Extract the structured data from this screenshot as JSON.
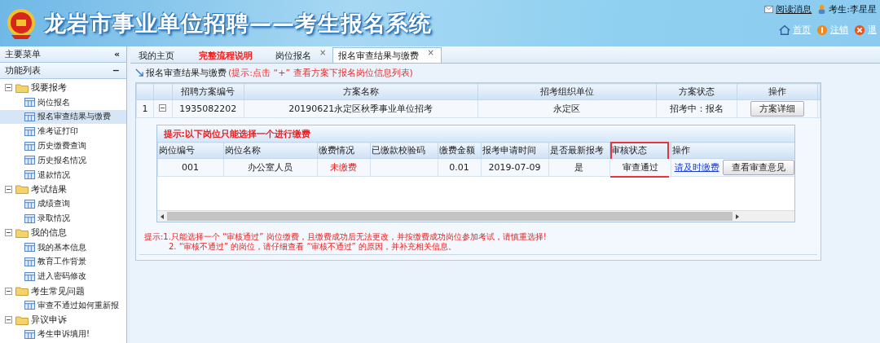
{
  "header": {
    "title": "龙岩市事业单位招聘——考生报名系统",
    "links": [
      {
        "kind": "message",
        "label": "阅读消息"
      },
      {
        "kind": "user",
        "label": "考生:李星星"
      }
    ],
    "nav": [
      {
        "kind": "home",
        "label": "首页"
      },
      {
        "kind": "help",
        "label": "注销"
      },
      {
        "kind": "exit",
        "label": "退"
      }
    ]
  },
  "sidebar": {
    "title": "主要菜单",
    "collapse": "«",
    "section": "功能列表",
    "section_toggle": "−",
    "tree": [
      {
        "label": "我要报考",
        "expanded": true,
        "children": [
          {
            "label": "岗位报名",
            "selected": false
          },
          {
            "label": "报名审查结果与缴费",
            "selected": true
          },
          {
            "label": "准考证打印",
            "selected": false
          },
          {
            "label": "历史缴费查询",
            "selected": false
          },
          {
            "label": "历史报名情况",
            "selected": false
          },
          {
            "label": "退款情况",
            "selected": false
          }
        ]
      },
      {
        "label": "考试结果",
        "expanded": true,
        "children": [
          {
            "label": "成绩查询",
            "selected": false
          },
          {
            "label": "录取情况",
            "selected": false
          }
        ]
      },
      {
        "label": "我的信息",
        "expanded": true,
        "children": [
          {
            "label": "我的基本信息",
            "selected": false
          },
          {
            "label": "教育工作背景",
            "selected": false
          },
          {
            "label": "进入密码修改",
            "selected": false
          }
        ]
      },
      {
        "label": "考生常见问题",
        "expanded": true,
        "children": [
          {
            "label": "审查不通过如何重新报",
            "selected": false
          }
        ]
      },
      {
        "label": "异议申诉",
        "expanded": true,
        "children": [
          {
            "label": "考生申诉填用!",
            "selected": false
          }
        ]
      }
    ]
  },
  "tabs": [
    {
      "label": "我的主页",
      "selected": false,
      "emphasis": false
    },
    {
      "label": "完整流程说明",
      "selected": false,
      "emphasis": true
    },
    {
      "label": "岗位报名",
      "selected": false,
      "emphasis": false,
      "close": "×"
    },
    {
      "label": "报名审查结果与缴费",
      "selected": true,
      "emphasis": false,
      "close": "×"
    }
  ],
  "panel": {
    "title": "报名审查结果与缴费",
    "hint": "(提示:点击 “+” 查看方案下报名岗位信息列表)"
  },
  "plans": {
    "columns": [
      "招聘方案编号",
      "方案名称",
      "招考组织单位",
      "方案状态",
      "操作"
    ],
    "rows": [
      {
        "index": "1",
        "expanded": true,
        "code": "1935082202",
        "name": "20190621永定区秋季事业单位招考",
        "unit": "永定区",
        "status": "招考中：报名",
        "action": "方案详细"
      }
    ]
  },
  "positions": {
    "notice": "提示:以下岗位只能选择一个进行缴费",
    "columns": [
      {
        "label": "岗位编号",
        "highlighted": false
      },
      {
        "label": "岗位名称",
        "highlighted": false
      },
      {
        "label": "缴费情况",
        "highlighted": false
      },
      {
        "label": "已缴款校验码",
        "highlighted": false
      },
      {
        "label": "缴费金额",
        "highlighted": false
      },
      {
        "label": "报考申请时间",
        "highlighted": false
      },
      {
        "label": "是否最新报考",
        "highlighted": false
      },
      {
        "label": "审核状态",
        "highlighted": true
      },
      {
        "label": "操作",
        "highlighted": false
      }
    ],
    "rows": [
      {
        "code": "001",
        "name": "办公室人员",
        "payment": "未缴费",
        "paid": false,
        "amount": "0.01",
        "date": "2019-07-09",
        "latest": "是",
        "review": "审查通过",
        "pay_link": "请及时缴费",
        "opinion_button": "查看审查意见"
      }
    ]
  },
  "notes": [
    "提示:1.只能选择一个 “审核通过” 岗位缴费，且缴费成功后无法更改，并按缴费成功岗位参加考试，请慎重选择!",
    "2. “审核不通过” 的岗位，请仔细查看 “审核不通过” 的原因，并补充相关信息。"
  ]
}
